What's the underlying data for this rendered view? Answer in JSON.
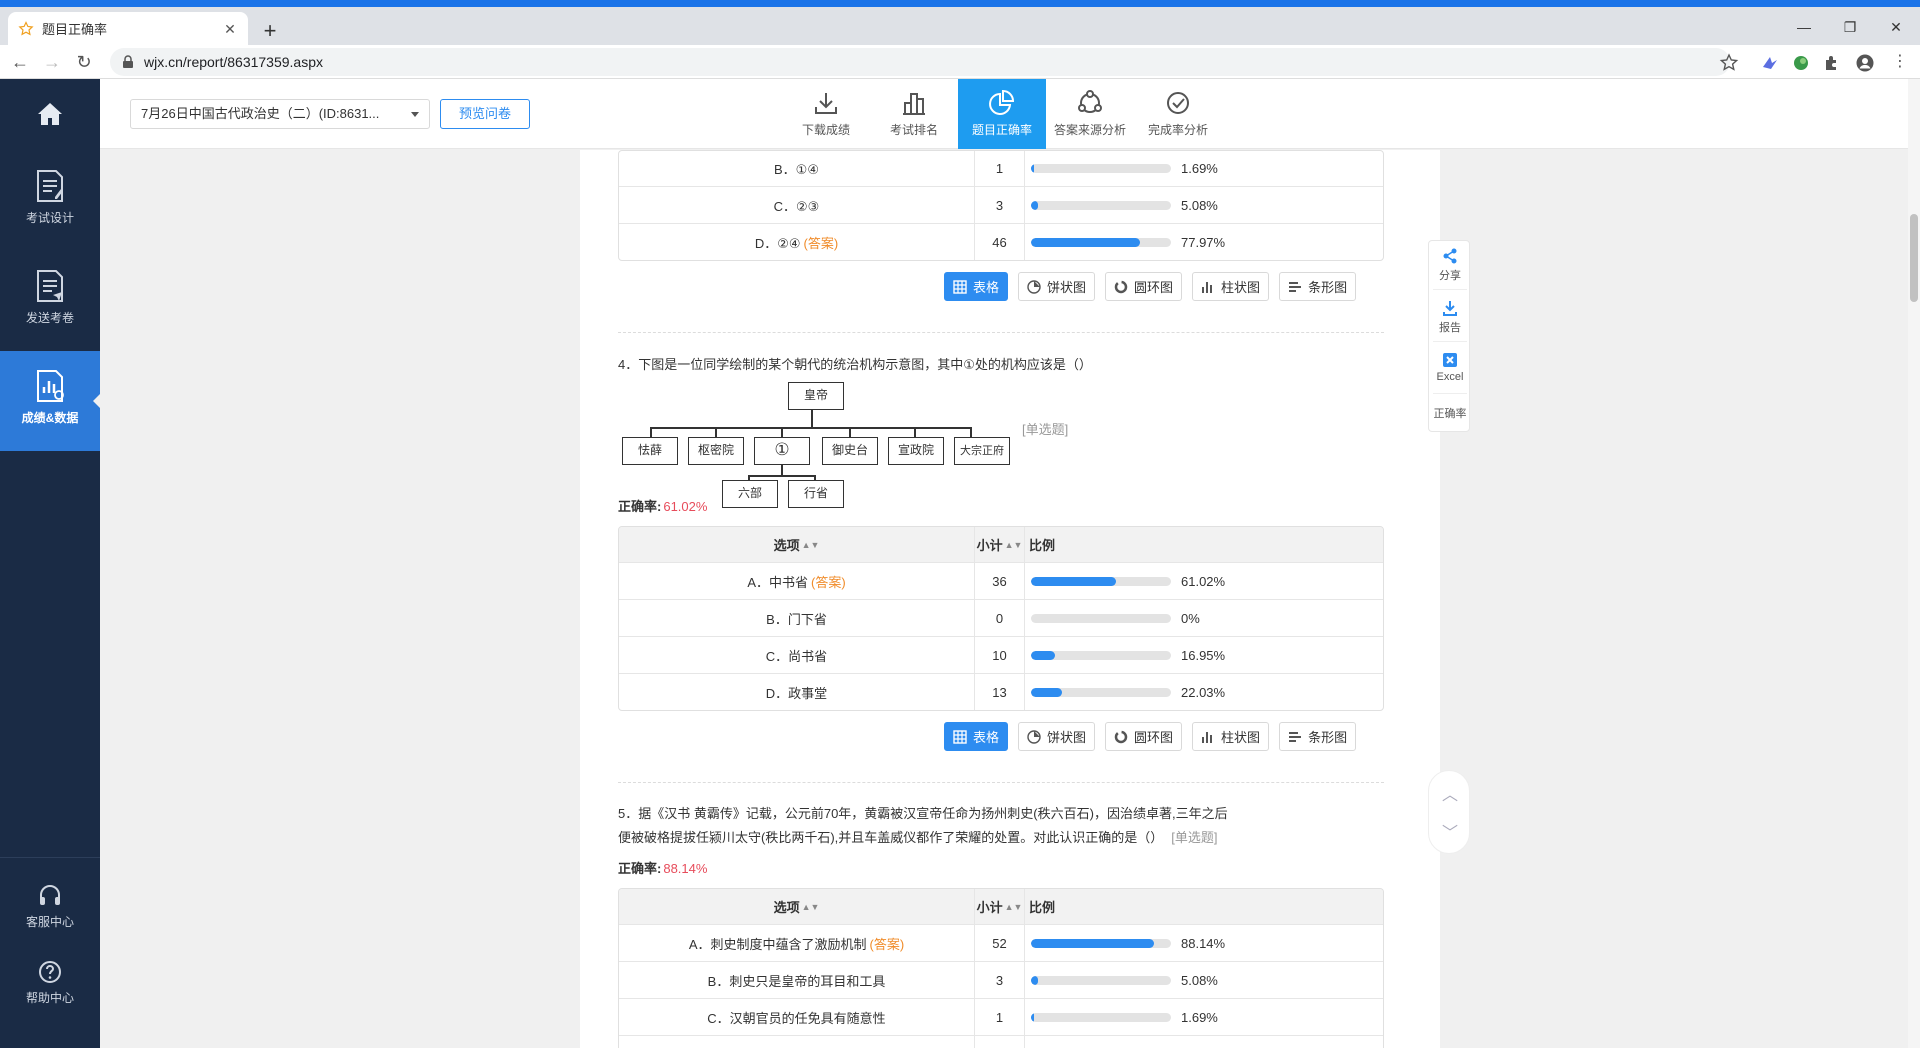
{
  "browser": {
    "tab_title": "题目正确率",
    "url": "wjx.cn/report/86317359.aspx"
  },
  "sidebar": {
    "items": [
      {
        "label": "考试设计",
        "icon": "doc-edit-icon"
      },
      {
        "label": "发送考卷",
        "icon": "doc-send-icon"
      },
      {
        "label": "成绩&数据",
        "icon": "chart-doc-icon",
        "active": true
      }
    ],
    "bottom": [
      {
        "label": "客服中心",
        "icon": "headset-icon"
      },
      {
        "label": "帮助中心",
        "icon": "help-icon"
      }
    ]
  },
  "header": {
    "survey_select": "7月26日中国古代政治史（二）(ID:8631...",
    "preview_button": "预览问卷",
    "nav": [
      {
        "label": "下载成绩",
        "icon": "download-icon"
      },
      {
        "label": "考试排名",
        "icon": "ranking-icon"
      },
      {
        "label": "题目正确率",
        "icon": "pie-icon",
        "active": true
      },
      {
        "label": "答案来源分析",
        "icon": "source-icon"
      },
      {
        "label": "完成率分析",
        "icon": "check-circle-icon"
      }
    ]
  },
  "table_labels": {
    "option": "选项",
    "count": "小计",
    "ratio": "比例",
    "answer_tag": "(答案)",
    "correct_label": "正确率:"
  },
  "view_buttons": [
    "表格",
    "饼状图",
    "圆环图",
    "柱状图",
    "条形图"
  ],
  "q3": {
    "rows": [
      {
        "option": "B．①④",
        "count": "1",
        "pct": "1.69%",
        "fraction": 0.0169,
        "answer": false
      },
      {
        "option": "C．②③",
        "count": "3",
        "pct": "5.08%",
        "fraction": 0.0508,
        "answer": false
      },
      {
        "option": "D．②④",
        "count": "46",
        "pct": "77.97%",
        "fraction": 0.7797,
        "answer": true
      }
    ]
  },
  "q4": {
    "title": "4．下图是一位同学绘制的某个朝代的统治机构示意图，其中①处的机构应该是（）",
    "type": "[单选题]",
    "rate": "61.02%",
    "diagram": {
      "top": "皇帝",
      "middle": [
        "怯薛",
        "枢密院",
        "①",
        "御史台",
        "宣政院",
        "大宗正府"
      ],
      "bottom": [
        "六部",
        "行省"
      ]
    },
    "rows": [
      {
        "option": "A．中书省",
        "count": "36",
        "pct": "61.02%",
        "fraction": 0.6102,
        "answer": true
      },
      {
        "option": "B．门下省",
        "count": "0",
        "pct": "0%",
        "fraction": 0,
        "answer": false
      },
      {
        "option": "C．尚书省",
        "count": "10",
        "pct": "16.95%",
        "fraction": 0.1695,
        "answer": false
      },
      {
        "option": "D．政事堂",
        "count": "13",
        "pct": "22.03%",
        "fraction": 0.2203,
        "answer": false
      }
    ]
  },
  "q5": {
    "title_line1": "5．据《汉书 黄霸传》记载，公元前70年，黄霸被汉宣帝任命为扬州刺史(秩六百石)，因治绩卓著,三年之后",
    "title_line2": "便被破格提拔任颍川太守(秩比两千石),并且车盖威仪都作了荣耀的处置。对此认识正确的是（）",
    "type": "[单选题]",
    "rate": "88.14%",
    "rows": [
      {
        "option": "A．刺史制度中蕴含了激励机制",
        "count": "52",
        "pct": "88.14%",
        "fraction": 0.8814,
        "answer": true
      },
      {
        "option": "B．刺史只是皇帝的耳目和工具",
        "count": "3",
        "pct": "5.08%",
        "fraction": 0.0508,
        "answer": false
      },
      {
        "option": "C．汉朝官员的任免具有随意性",
        "count": "1",
        "pct": "1.69%",
        "fraction": 0.0169,
        "answer": false
      }
    ]
  },
  "right_toolbar": [
    "分享",
    "报告",
    "Excel",
    "正确率"
  ],
  "colors": {
    "accent": "#2d8cf0",
    "sidebar": "#1a2b45",
    "answer": "#f08c2a",
    "rate": "#e74c5b"
  }
}
